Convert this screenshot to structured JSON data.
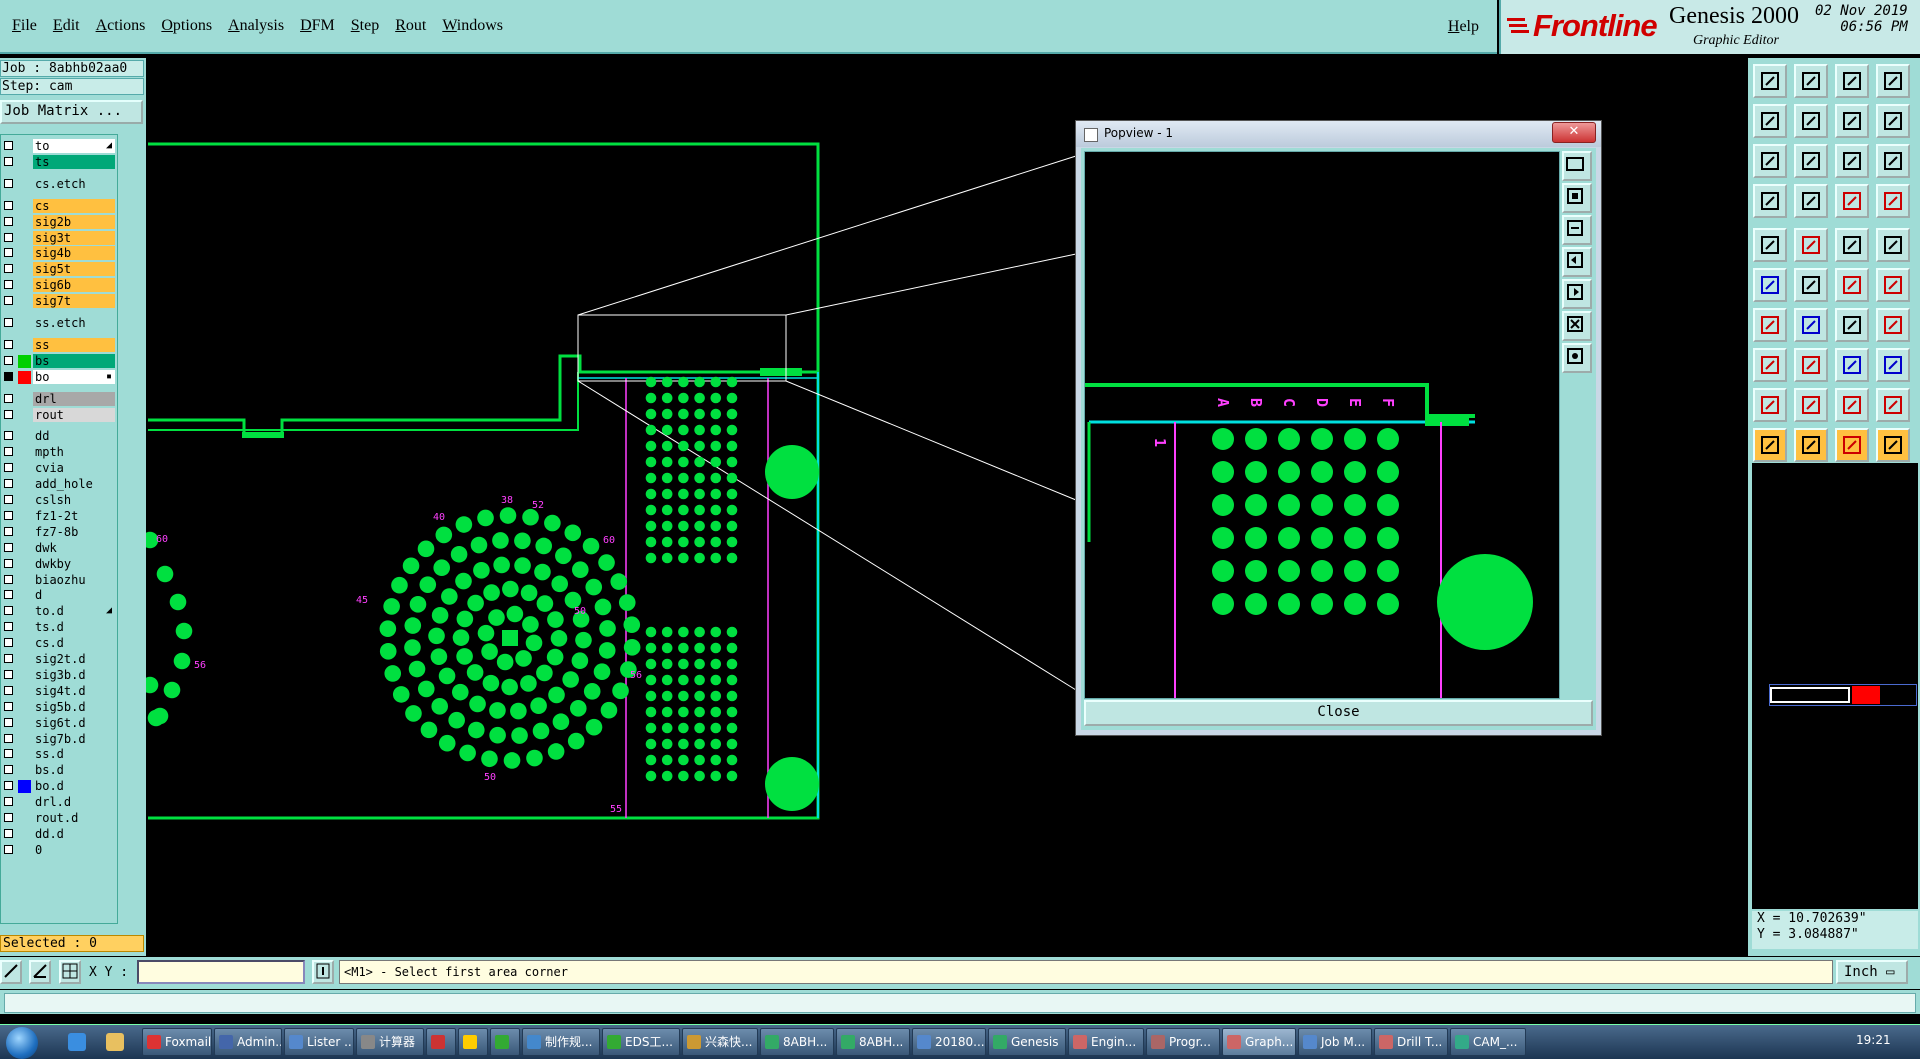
{
  "menu": {
    "items": [
      "File",
      "Edit",
      "Actions",
      "Options",
      "Analysis",
      "DFM",
      "Step",
      "Rout",
      "Windows"
    ],
    "help": "Help"
  },
  "brand": {
    "logo": "Frontline",
    "product": "Genesis 2000",
    "subtitle": "Graphic Editor",
    "date": "02 Nov 2019",
    "time": "06:56 PM"
  },
  "job": {
    "job_label": "Job : 8abhb02aa0",
    "step_label": "Step: cam",
    "matrix_button": "Job Matrix ..."
  },
  "layers": [
    {
      "name": "to",
      "bg": "#ffffff",
      "sw": "",
      "mark": "◢"
    },
    {
      "name": "ts",
      "bg": "#00a878",
      "sw": ""
    },
    {
      "name": "cs.etch",
      "bg": "#9fdcd6",
      "sw": ""
    },
    {
      "name": "cs",
      "bg": "#ffc040",
      "sw": ""
    },
    {
      "name": "sig2b",
      "bg": "#ffc040",
      "sw": ""
    },
    {
      "name": "sig3t",
      "bg": "#ffc040",
      "sw": ""
    },
    {
      "name": "sig4b",
      "bg": "#ffc040",
      "sw": ""
    },
    {
      "name": "sig5t",
      "bg": "#ffc040",
      "sw": ""
    },
    {
      "name": "sig6b",
      "bg": "#ffc040",
      "sw": ""
    },
    {
      "name": "sig7t",
      "bg": "#ffc040",
      "sw": ""
    },
    {
      "name": "ss.etch",
      "bg": "#9fdcd6",
      "sw": ""
    },
    {
      "name": "ss",
      "bg": "#ffc040",
      "sw": ""
    },
    {
      "name": "bs",
      "bg": "#00a878",
      "sw": "#00d000"
    },
    {
      "name": "bo",
      "bg": "#ffffff",
      "sw": "#ff0000",
      "mark": "▪"
    },
    {
      "name": "drl",
      "bg": "#a8a8a8",
      "sw": ""
    },
    {
      "name": "rout",
      "bg": "#d8d8d8",
      "sw": ""
    },
    {
      "name": "dd",
      "bg": "#9fdcd6",
      "sw": ""
    },
    {
      "name": "mpth",
      "bg": "#9fdcd6",
      "sw": ""
    },
    {
      "name": "cvia",
      "bg": "#9fdcd6",
      "sw": ""
    },
    {
      "name": "add_hole",
      "bg": "#9fdcd6",
      "sw": ""
    },
    {
      "name": "cslsh",
      "bg": "#9fdcd6",
      "sw": ""
    },
    {
      "name": "fz1-2t",
      "bg": "#9fdcd6",
      "sw": ""
    },
    {
      "name": "fz7-8b",
      "bg": "#9fdcd6",
      "sw": ""
    },
    {
      "name": "dwk",
      "bg": "#9fdcd6",
      "sw": ""
    },
    {
      "name": "dwkby",
      "bg": "#9fdcd6",
      "sw": ""
    },
    {
      "name": "biaozhu",
      "bg": "#9fdcd6",
      "sw": ""
    },
    {
      "name": "d",
      "bg": "#9fdcd6",
      "sw": ""
    },
    {
      "name": "to.d",
      "bg": "#9fdcd6",
      "sw": "",
      "mark": "◢"
    },
    {
      "name": "ts.d",
      "bg": "#9fdcd6",
      "sw": ""
    },
    {
      "name": "cs.d",
      "bg": "#9fdcd6",
      "sw": ""
    },
    {
      "name": "sig2t.d",
      "bg": "#9fdcd6",
      "sw": ""
    },
    {
      "name": "sig3b.d",
      "bg": "#9fdcd6",
      "sw": ""
    },
    {
      "name": "sig4t.d",
      "bg": "#9fdcd6",
      "sw": ""
    },
    {
      "name": "sig5b.d",
      "bg": "#9fdcd6",
      "sw": ""
    },
    {
      "name": "sig6t.d",
      "bg": "#9fdcd6",
      "sw": ""
    },
    {
      "name": "sig7b.d",
      "bg": "#9fdcd6",
      "sw": ""
    },
    {
      "name": "ss.d",
      "bg": "#9fdcd6",
      "sw": ""
    },
    {
      "name": "bs.d",
      "bg": "#9fdcd6",
      "sw": ""
    },
    {
      "name": "bo.d",
      "bg": "#9fdcd6",
      "sw": "#0000ff"
    },
    {
      "name": "drl.d",
      "bg": "#9fdcd6",
      "sw": ""
    },
    {
      "name": "rout.d",
      "bg": "#9fdcd6",
      "sw": ""
    },
    {
      "name": "dd.d",
      "bg": "#9fdcd6",
      "sw": ""
    },
    {
      "name": "0",
      "bg": "#9fdcd6",
      "sw": ""
    }
  ],
  "selected": "Selected : 0",
  "coords": {
    "x": "X = 10.702639\"",
    "y": "Y = 3.084887\""
  },
  "command": {
    "xy_label": "X Y :",
    "xy_value": "",
    "prompt": "<M1> - Select first area corner",
    "unit": "Inch"
  },
  "popview": {
    "title": "Popview - 1",
    "close_label": "Close",
    "window_close": "✕"
  },
  "canvas_labels": {
    "columns": [
      "A",
      "B",
      "C",
      "D",
      "E",
      "F"
    ],
    "row1": "1",
    "ring": [
      "40",
      "38",
      "52",
      "60",
      "45",
      "56",
      "50",
      "55",
      "60",
      "56",
      "50"
    ]
  },
  "taskbar": {
    "tasks": [
      "Foxmail",
      "Admin...",
      "Lister ...",
      "计算器",
      "",
      "",
      "",
      "制作规...",
      "EDS工...",
      "兴森快...",
      "8ABH...",
      "8ABH...",
      "20180...",
      "Genesis",
      "Engin...",
      "Progr...",
      "Graph...",
      "Job M...",
      "Drill T...",
      "CAM_..."
    ],
    "active": "Graph...",
    "clock": "19:21"
  },
  "colors": {
    "panel": "#9fdcd6",
    "copper": "#00e040",
    "outline": "#00e0e0",
    "silk": "#ff40ff",
    "highlight": "#ffd060"
  }
}
